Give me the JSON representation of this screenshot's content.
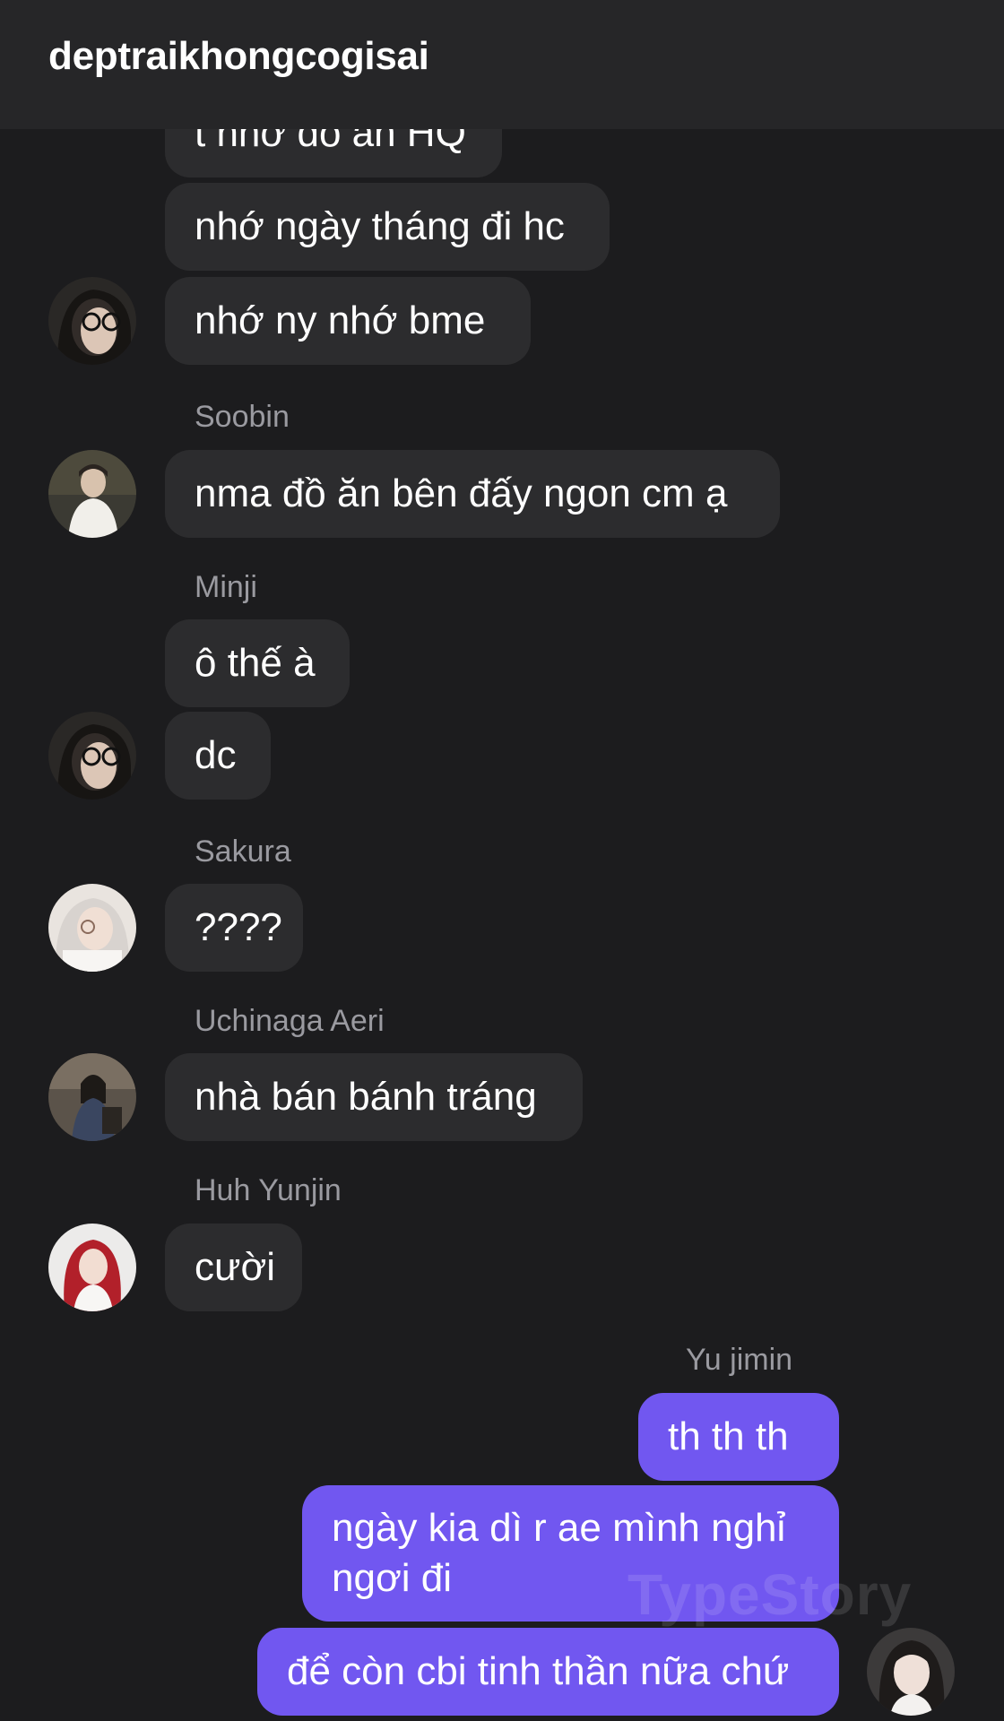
{
  "header": {
    "title": "deptraikhongcogisai"
  },
  "messages": [
    {
      "text": "t nhớ đồ ăn HQ"
    },
    {
      "text": "nhớ ngày tháng đi hc"
    },
    {
      "text": "nhớ ny nhớ bme"
    },
    {
      "sender": "Soobin",
      "text": "nma đồ ăn bên đấy ngon cm ạ"
    },
    {
      "sender": "Minji",
      "text": "ô thế à"
    },
    {
      "text": "dc"
    },
    {
      "sender": "Sakura",
      "text": "????"
    },
    {
      "sender": "Uchinaga Aeri",
      "text": "nhà bán bánh tráng"
    },
    {
      "sender": "Huh Yunjin",
      "text": "cười"
    },
    {
      "sender": "Yu jimin",
      "text": "th th th"
    },
    {
      "text_line1": "ngày kia dì r ae mình nghỉ",
      "text_line2": "ngơi đi"
    },
    {
      "text": "để còn cbi tinh thần nữa chứ"
    }
  ],
  "colors": {
    "background": "#1c1c1e",
    "incoming_bubble": "#2c2c2e",
    "outgoing_bubble": "#7157f0",
    "sender_name": "#9a9aa0"
  },
  "avatars": {
    "minji": "avatar-minji-glasses-photo",
    "soobin": "avatar-soobin-photo",
    "sakura": "avatar-sakura-photo",
    "aeri": "avatar-aeri-photo",
    "yunjin": "avatar-yunjin-photo",
    "jimin": "avatar-jimin-photo"
  },
  "watermark": "TypeStory"
}
